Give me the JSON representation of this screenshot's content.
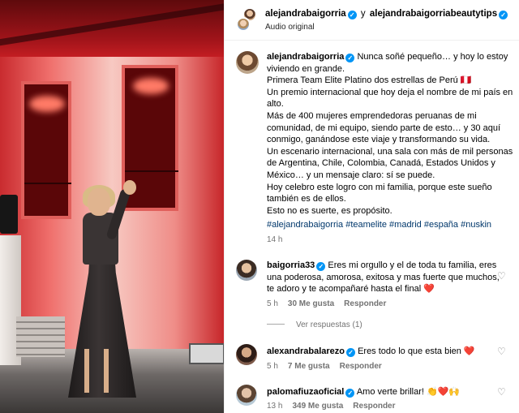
{
  "header": {
    "user1": "alejandrabaigorria",
    "connector": "y",
    "user2": "alejandrabaigorriabeautytips",
    "audio": "Audio original"
  },
  "caption": {
    "username": "alejandrabaigorria",
    "line1": "Nunca soñé pequeño… y hoy lo estoy viviendo en grande.",
    "line2": "Primera Team Elite Platino dos estrellas de Perú 🇵🇪",
    "line3": "Un premio internacional que hoy deja el nombre de mi país en alto.",
    "line4": "Más de 400 mujeres emprendedoras peruanas de mi comunidad, de mi equipo, siendo parte de esto… y 30 aquí conmigo, ganándose este viaje y transformando su vida.",
    "line5": "Un escenario internacional, una sala con más de mil personas de Argentina, Chile, Colombia, Canadá, Estados Unidos y México… y un mensaje claro: sí se puede.",
    "line6": "Hoy celebro este logro con mi familia, porque este sueño también es de ellos.",
    "line7": "Esto no es suerte, es propósito.",
    "hashtags": "#alejandrabaigorria #teamelite #madrid #españa #nuskin",
    "time": "14 h"
  },
  "comments": [
    {
      "username": "baigorria33",
      "text": "Eres mi orgullo y el de toda tu familia, eres una poderosa, amorosa, exitosa y mas fuerte que muchos, te adoro y te acompañaré hasta el final ❤️",
      "time": "5 h",
      "likes": "30 Me gusta",
      "reply": "Responder",
      "view_replies": "Ver respuestas (1)"
    },
    {
      "username": "alexandrabalarezo",
      "text": "Eres todo lo que esta bien ❤️",
      "time": "5 h",
      "likes": "7 Me gusta",
      "reply": "Responder"
    },
    {
      "username": "palomafiuzaoficial",
      "text": "Amo verte brillar! 👏❤️🙌",
      "time": "13 h",
      "likes": "349 Me gusta",
      "reply": "Responder"
    }
  ],
  "icons": {
    "verified": "verified-badge-icon",
    "like": "heart-outline-icon"
  },
  "colors": {
    "accent": "#0095f6",
    "hashtag": "#00376b",
    "muted": "#737373"
  }
}
